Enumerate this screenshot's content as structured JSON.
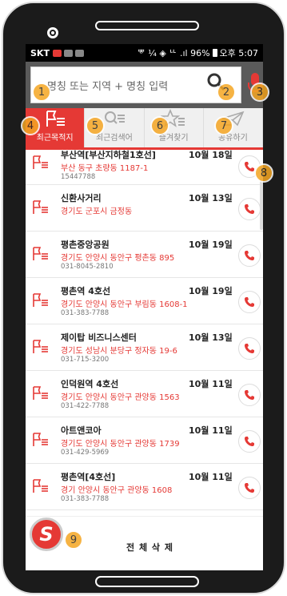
{
  "status_bar": {
    "carrier": "SKT",
    "right_text": "ᄬ ¼ ◈ ᄔ .ıl 96%",
    "time": "오후 5:07"
  },
  "search": {
    "placeholder": "명칭 또는 지역 + 명칭 입력"
  },
  "tabs": [
    {
      "label": "최근목적지",
      "active": true
    },
    {
      "label": "최근검색어",
      "active": false
    },
    {
      "label": "즐겨찾기",
      "active": false
    },
    {
      "label": "공유하기",
      "active": false
    }
  ],
  "items": [
    {
      "name": "부산역[부산지하철1호선]",
      "date": "10월 18일",
      "address": "부산 동구 초량동 1187-1",
      "phone": "15447788"
    },
    {
      "name": "신환사거리",
      "date": "10월 13일",
      "address": "경기도 군포시 금정동",
      "phone": ""
    },
    {
      "name": "평촌중앙공원",
      "date": "10월 19일",
      "address": "경기도 안양시 동안구 평촌동 895",
      "phone": "031-8045-2810"
    },
    {
      "name": "평촌역 4호선",
      "date": "10월 19일",
      "address": "경기도 안양시 동안구 부림동 1608-1",
      "phone": "031-383-7788"
    },
    {
      "name": "제이탑 비즈니스센터",
      "date": "10월 13일",
      "address": "경기도 성남시 분당구 정자동 19-6",
      "phone": "031-715-3200"
    },
    {
      "name": "인덕원역 4호선",
      "date": "10월 11일",
      "address": "경기도 안양시 동안구 관양동 1563",
      "phone": "031-422-7788"
    },
    {
      "name": "아트앤코아",
      "date": "10월 11일",
      "address": "경기도 안양시 동안구 관양동 1739",
      "phone": "031-429-5969"
    },
    {
      "name": "평촌역[4호선]",
      "date": "10월 11일",
      "address": "경기 안양시 동안구 관양동 1608",
      "phone": "031-383-7788"
    }
  ],
  "bottom": {
    "logo_letter": "S",
    "delete_all": "전 체 삭 제"
  },
  "badges": [
    "1",
    "2",
    "3",
    "4",
    "5",
    "6",
    "7",
    "8",
    "9"
  ],
  "colors": {
    "accent": "#e53935",
    "badge": "#f5a623"
  }
}
